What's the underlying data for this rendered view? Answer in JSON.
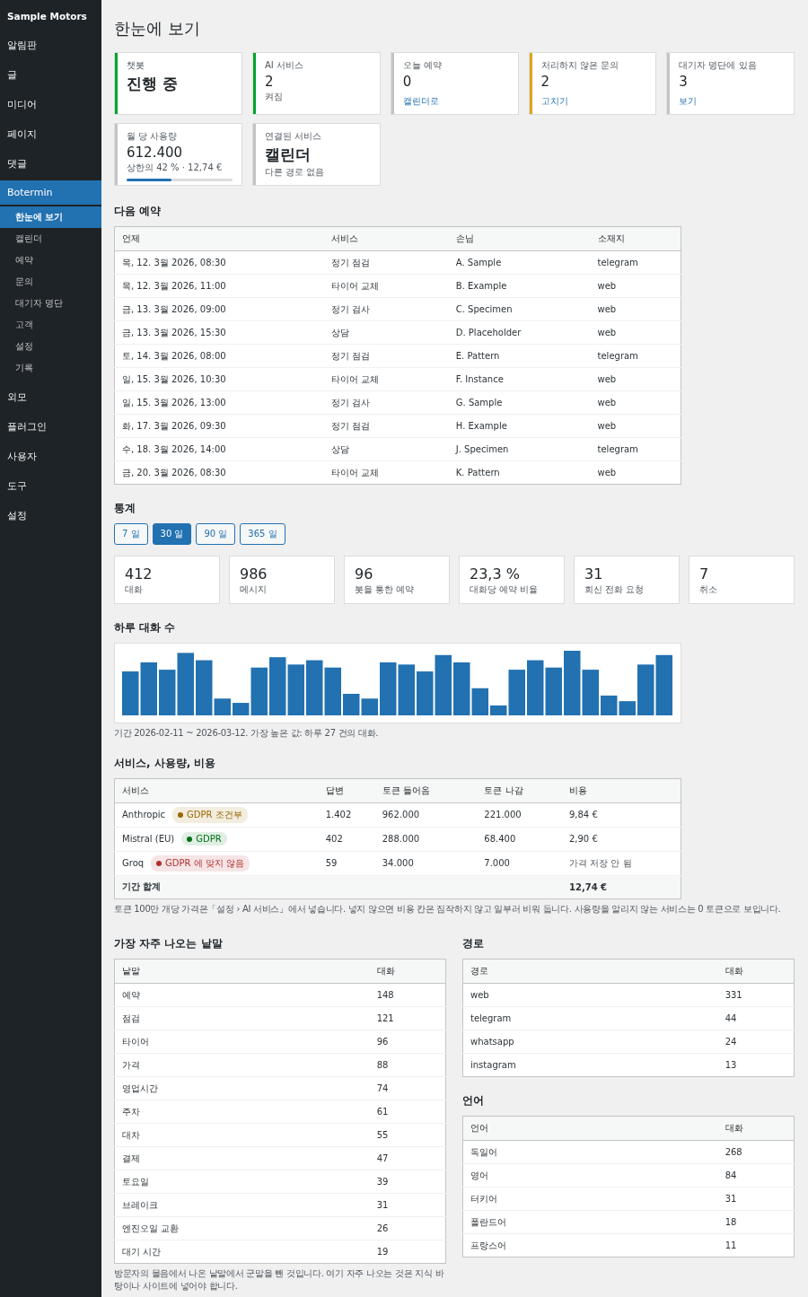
{
  "sidebar": {
    "brand": "Sample Motors",
    "items": [
      {
        "label": "알림판",
        "selected": false
      },
      {
        "label": "글",
        "selected": false
      },
      {
        "label": "미디어",
        "selected": false
      },
      {
        "label": "페이지",
        "selected": false
      },
      {
        "label": "댓글",
        "selected": false
      },
      {
        "label": "Botermin",
        "selected": true,
        "children": [
          {
            "label": "한눈에 보기",
            "selected": true
          },
          {
            "label": "캘린더",
            "selected": false
          },
          {
            "label": "예약",
            "selected": false
          },
          {
            "label": "문의",
            "selected": false
          },
          {
            "label": "대기자 명단",
            "selected": false
          },
          {
            "label": "고객",
            "selected": false
          },
          {
            "label": "설정",
            "selected": false
          },
          {
            "label": "기록",
            "selected": false
          }
        ]
      },
      {
        "label": "외모",
        "selected": false
      },
      {
        "label": "플러그인",
        "selected": false
      },
      {
        "label": "사용자",
        "selected": false
      },
      {
        "label": "도구",
        "selected": false
      },
      {
        "label": "설정",
        "selected": false
      }
    ]
  },
  "page_title": "한눈에 보기",
  "status_cards": [
    {
      "kind": "plain",
      "label": "챗봇",
      "value": "진행 중",
      "color": "#00a32a"
    },
    {
      "kind": "note",
      "label": "AI 서비스",
      "value": "2",
      "note": "켜짐",
      "color": "#00a32a"
    },
    {
      "kind": "link",
      "label": "오늘 예약",
      "value": "0",
      "link": "캘린더로",
      "color": "#c3c4c7"
    },
    {
      "kind": "link",
      "label": "처리하지 않은 문의",
      "value": "2",
      "link": "고치기",
      "color": "#dba617"
    },
    {
      "kind": "link",
      "label": "대기자 명단에 있음",
      "value": "3",
      "link": "보기",
      "color": "#c3c4c7"
    },
    {
      "kind": "meter",
      "label": "월 당 사용량",
      "value": "612.400",
      "note": "상한의 42 % · 12,74 €",
      "level": 0.42,
      "color": "#c3c4c7"
    },
    {
      "kind": "note",
      "label": "연결된 서비스",
      "value": "캘린더",
      "note": "다른 경로 없음",
      "color": "#c3c4c7"
    }
  ],
  "upcoming": {
    "title": "다음 예약",
    "columns": [
      "언제",
      "서비스",
      "손님",
      "소재지"
    ],
    "rows": [
      [
        "목, 12. 3월 2026, 08:30",
        "정기 점검",
        "A. Sample",
        "telegram"
      ],
      [
        "목, 12. 3월 2026, 11:00",
        "타이어 교체",
        "B. Example",
        "web"
      ],
      [
        "금, 13. 3월 2026, 09:00",
        "정기 검사",
        "C. Specimen",
        "web"
      ],
      [
        "금, 13. 3월 2026, 15:30",
        "상담",
        "D. Placeholder",
        "web"
      ],
      [
        "토, 14. 3월 2026, 08:00",
        "정기 점검",
        "E. Pattern",
        "telegram"
      ],
      [
        "일, 15. 3월 2026, 10:30",
        "타이어 교체",
        "F. Instance",
        "web"
      ],
      [
        "일, 15. 3월 2026, 13:00",
        "정기 검사",
        "G. Sample",
        "web"
      ],
      [
        "화, 17. 3월 2026, 09:30",
        "정기 점검",
        "H. Example",
        "web"
      ],
      [
        "수, 18. 3월 2026, 14:00",
        "상담",
        "J. Specimen",
        "telegram"
      ],
      [
        "금, 20. 3월 2026, 08:30",
        "타이어 교체",
        "K. Pattern",
        "web"
      ]
    ]
  },
  "stats": {
    "title": "통계",
    "ranges": [
      {
        "label": "7 일",
        "selected": false
      },
      {
        "label": "30 일",
        "selected": true
      },
      {
        "label": "90 일",
        "selected": false
      },
      {
        "label": "365 일",
        "selected": false
      }
    ],
    "tiles": [
      {
        "value": "412",
        "label": "대화"
      },
      {
        "value": "986",
        "label": "메시지"
      },
      {
        "value": "96",
        "label": "봇을 통한 예약"
      },
      {
        "value": "23,3 %",
        "label": "대화당 예약 비율"
      },
      {
        "value": "31",
        "label": "회신 전화 요청"
      },
      {
        "value": "7",
        "label": "취소"
      }
    ]
  },
  "daily_chart": {
    "title": "하루 대화 수",
    "caption": "기간 2026-02-11 ~ 2026-03-12. 가장 높은 값: 하루 27 건의 대화."
  },
  "services": {
    "title": "서비스, 사용량, 비용",
    "columns": [
      "서비스",
      "답변",
      "토큰 들어옴",
      "토큰 나감",
      "비용"
    ],
    "rows": [
      {
        "badge": "GDPR 조건부",
        "color": "#996800",
        "cells": [
          "Anthropic",
          "1.402",
          "962.000",
          "221.000",
          "9,84 €"
        ],
        "cost_missing": false
      },
      {
        "badge": "GDPR",
        "color": "#007017",
        "cells": [
          "Mistral (EU)",
          "402",
          "288.000",
          "68.400",
          "2,90 €"
        ],
        "cost_missing": false
      },
      {
        "badge": "GDPR 에 맞지 않음",
        "color": "#b32d2e",
        "cells": [
          "Groq",
          "59",
          "34.000",
          "7.000",
          "가격 저장 안 됨"
        ],
        "cost_missing": true
      }
    ],
    "total_label": "기간 합계",
    "total": "12,74 €",
    "note": "토큰 100만 개당 가격은「설정 › AI 서비스」에서 넣습니다. 넣지 않으면 비용 칸은 짐작하지 않고 일부러 비워 둡니다. 사용량을 알리지 않는 서비스는 0 토큰으로 보입니다."
  },
  "top_words": {
    "title": "가장 자주 나오는 낱말",
    "columns": [
      "낱말",
      "대화"
    ],
    "rows": [
      [
        "예약",
        "148"
      ],
      [
        "점검",
        "121"
      ],
      [
        "타이어",
        "96"
      ],
      [
        "가격",
        "88"
      ],
      [
        "영업시간",
        "74"
      ],
      [
        "주차",
        "61"
      ],
      [
        "대차",
        "55"
      ],
      [
        "결제",
        "47"
      ],
      [
        "토요일",
        "39"
      ],
      [
        "브레이크",
        "31"
      ],
      [
        "엔진오일 교환",
        "26"
      ],
      [
        "대기 시간",
        "19"
      ]
    ],
    "note": "방문자의 물음에서 나온 낱말에서 군말을 뺀 것입니다. 여기 자주 나오는 것은 지식 바탕이나 사이트에 넣어야 합니다."
  },
  "channels": {
    "title": "경로",
    "columns": [
      "경로",
      "대화"
    ],
    "rows": [
      [
        "web",
        "331"
      ],
      [
        "telegram",
        "44"
      ],
      [
        "whatsapp",
        "24"
      ],
      [
        "instagram",
        "13"
      ]
    ]
  },
  "languages": {
    "title": "언어",
    "columns": [
      "언어",
      "대화"
    ],
    "rows": [
      [
        "독일어",
        "268"
      ],
      [
        "영어",
        "84"
      ],
      [
        "터키어",
        "31"
      ],
      [
        "폴란드어",
        "18"
      ],
      [
        "프랑스어",
        "11"
      ]
    ]
  }
}
